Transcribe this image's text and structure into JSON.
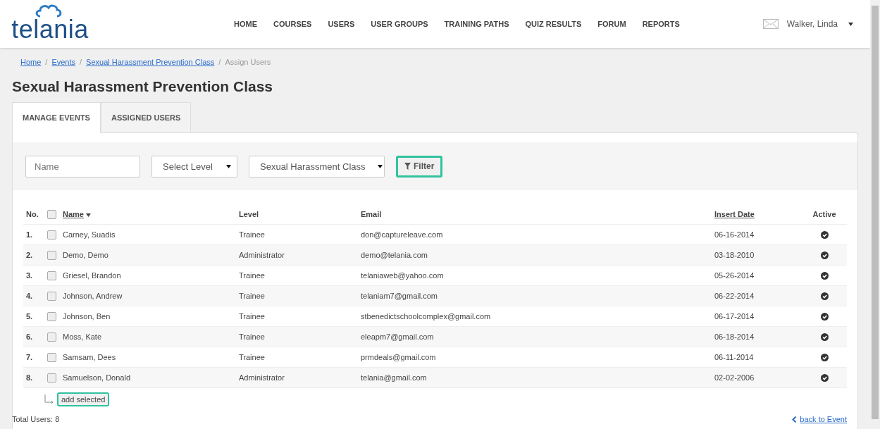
{
  "header": {
    "logo": "telania",
    "nav": [
      {
        "label": "HOME"
      },
      {
        "label": "COURSES"
      },
      {
        "label": "USERS"
      },
      {
        "label": "USER GROUPS"
      },
      {
        "label": "TRAINING PATHS"
      },
      {
        "label": "QUIZ RESULTS"
      },
      {
        "label": "FORUM"
      },
      {
        "label": "REPORTS"
      }
    ],
    "user": "Walker, Linda"
  },
  "breadcrumb": [
    {
      "label": "Home",
      "link": true
    },
    {
      "label": "Events",
      "link": true
    },
    {
      "label": "Sexual Harassment Prevention Class",
      "link": true
    },
    {
      "label": "Assign Users",
      "link": false
    }
  ],
  "breadcrumb_separator": "/",
  "title": "Sexual Harassment Prevention Class",
  "tabs": [
    {
      "label": "MANAGE EVENTS",
      "selected": true
    },
    {
      "label": "ASSIGNED USERS",
      "selected": false
    }
  ],
  "filters": {
    "name_placeholder": "Name",
    "level": "Select Level",
    "event": "Sexual Harassment Class",
    "button": "Filter"
  },
  "table": {
    "columns": {
      "no": "No.",
      "name": "Name",
      "level": "Level",
      "email": "Email",
      "date": "Insert Date",
      "active": "Active"
    },
    "select_all_checked": false,
    "rows": [
      {
        "no": "1.",
        "name": "Carney, Suadis",
        "level": "Trainee",
        "email": "don@captureleave.com",
        "date": "06-16-2014",
        "active": true,
        "checked": false
      },
      {
        "no": "2.",
        "name": "Demo, Demo",
        "level": "Administrator",
        "email": "demo@telania.com",
        "date": "03-18-2010",
        "active": true,
        "checked": false
      },
      {
        "no": "3.",
        "name": "Griesel, Brandon",
        "level": "Trainee",
        "email": "telaniaweb@yahoo.com",
        "date": "05-26-2014",
        "active": true,
        "checked": false
      },
      {
        "no": "4.",
        "name": "Johnson, Andrew",
        "level": "Trainee",
        "email": "telaniam7@gmail.com",
        "date": "06-22-2014",
        "active": true,
        "checked": false
      },
      {
        "no": "5.",
        "name": "Johnson, Ben",
        "level": "Trainee",
        "email": "stbenedictschoolcomplex@gmail.com",
        "date": "06-17-2014",
        "active": true,
        "checked": false
      },
      {
        "no": "6.",
        "name": "Moss, Kate",
        "level": "Trainee",
        "email": "eleapm7@gmail.com",
        "date": "06-18-2014",
        "active": true,
        "checked": false
      },
      {
        "no": "7.",
        "name": "Samsam, Dees",
        "level": "Trainee",
        "email": "prmdeals@gmail.com",
        "date": "06-11-2014",
        "active": true,
        "checked": false
      },
      {
        "no": "8.",
        "name": "Samuelson, Donald",
        "level": "Administrator",
        "email": "telania@gmail.com",
        "date": "02-02-2006",
        "active": true,
        "checked": false
      }
    ]
  },
  "add_button": "add selected",
  "total": "Total Users: 8",
  "back_link": "back to Event"
}
